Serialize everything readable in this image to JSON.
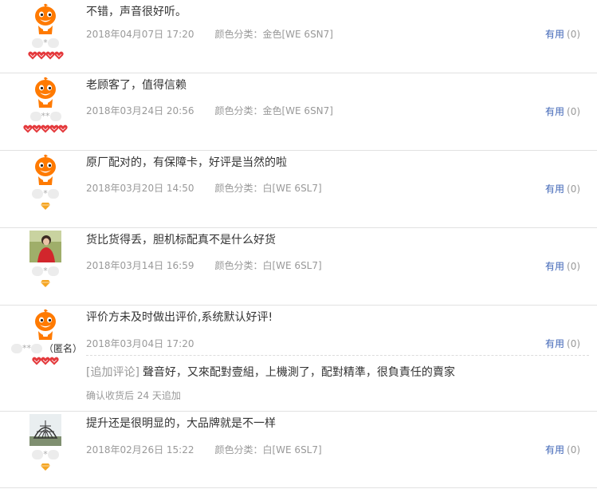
{
  "useful_label": "有用",
  "reviews": [
    {
      "nick": "*",
      "avatar": "orange-mascot",
      "rank": {
        "type": "heart",
        "count": 4
      },
      "content": "不错，声音很好听。",
      "date": "2018年04月07日 17:20",
      "sku": "颜色分类：金色[WE 6SN7]",
      "useful_count": "(0)"
    },
    {
      "nick": "**",
      "avatar": "orange-mascot",
      "rank": {
        "type": "heart",
        "count": 5
      },
      "content": "老顾客了，值得信赖",
      "date": "2018年03月24日 20:56",
      "sku": "颜色分类：金色[WE 6SN7]",
      "useful_count": "(0)"
    },
    {
      "nick": "*",
      "avatar": "orange-mascot",
      "rank": {
        "type": "diamond",
        "count": 1
      },
      "content": "原厂配对的，有保障卡，好评是当然的啦",
      "date": "2018年03月20日 14:50",
      "sku": "颜色分类：白[WE 6SL7]",
      "useful_count": "(0)"
    },
    {
      "nick": "*",
      "avatar": "photo-person-red",
      "rank": {
        "type": "diamond",
        "count": 1
      },
      "content": "货比货得丢，胆机标配真不是什么好货",
      "date": "2018年03月14日 16:59",
      "sku": "颜色分类：白[WE 6SL7]",
      "useful_count": "(0)"
    },
    {
      "nick": "**",
      "anon": "（匿名）",
      "avatar": "orange-mascot",
      "rank": {
        "type": "heart",
        "count": 3
      },
      "content": "评价方未及时做出评价,系统默认好评!",
      "date": "2018年03月04日 17:20",
      "sku": "",
      "useful_count": "(0)",
      "append_tag": "[追加评论]",
      "append_text": "聲音好，又來配對壹組，上機測了，配對精準，很負責任的賣家",
      "append_time": "确认收货后 24 天追加"
    },
    {
      "nick": "*",
      "avatar": "photo-dome",
      "rank": {
        "type": "diamond",
        "count": 1
      },
      "content": "提升还是很明显的，大品牌就是不一样",
      "date": "2018年02月26日 15:22",
      "sku": "颜色分类：白[WE 6SL7]",
      "useful_count": "(0)"
    }
  ],
  "colors": {
    "useful_link": "#3e64b6",
    "meta_text": "#999999",
    "heart": "#e4393c",
    "diamond": "#f5a623",
    "mascot": "#ff7a00",
    "divider": "#e1e1e1"
  }
}
